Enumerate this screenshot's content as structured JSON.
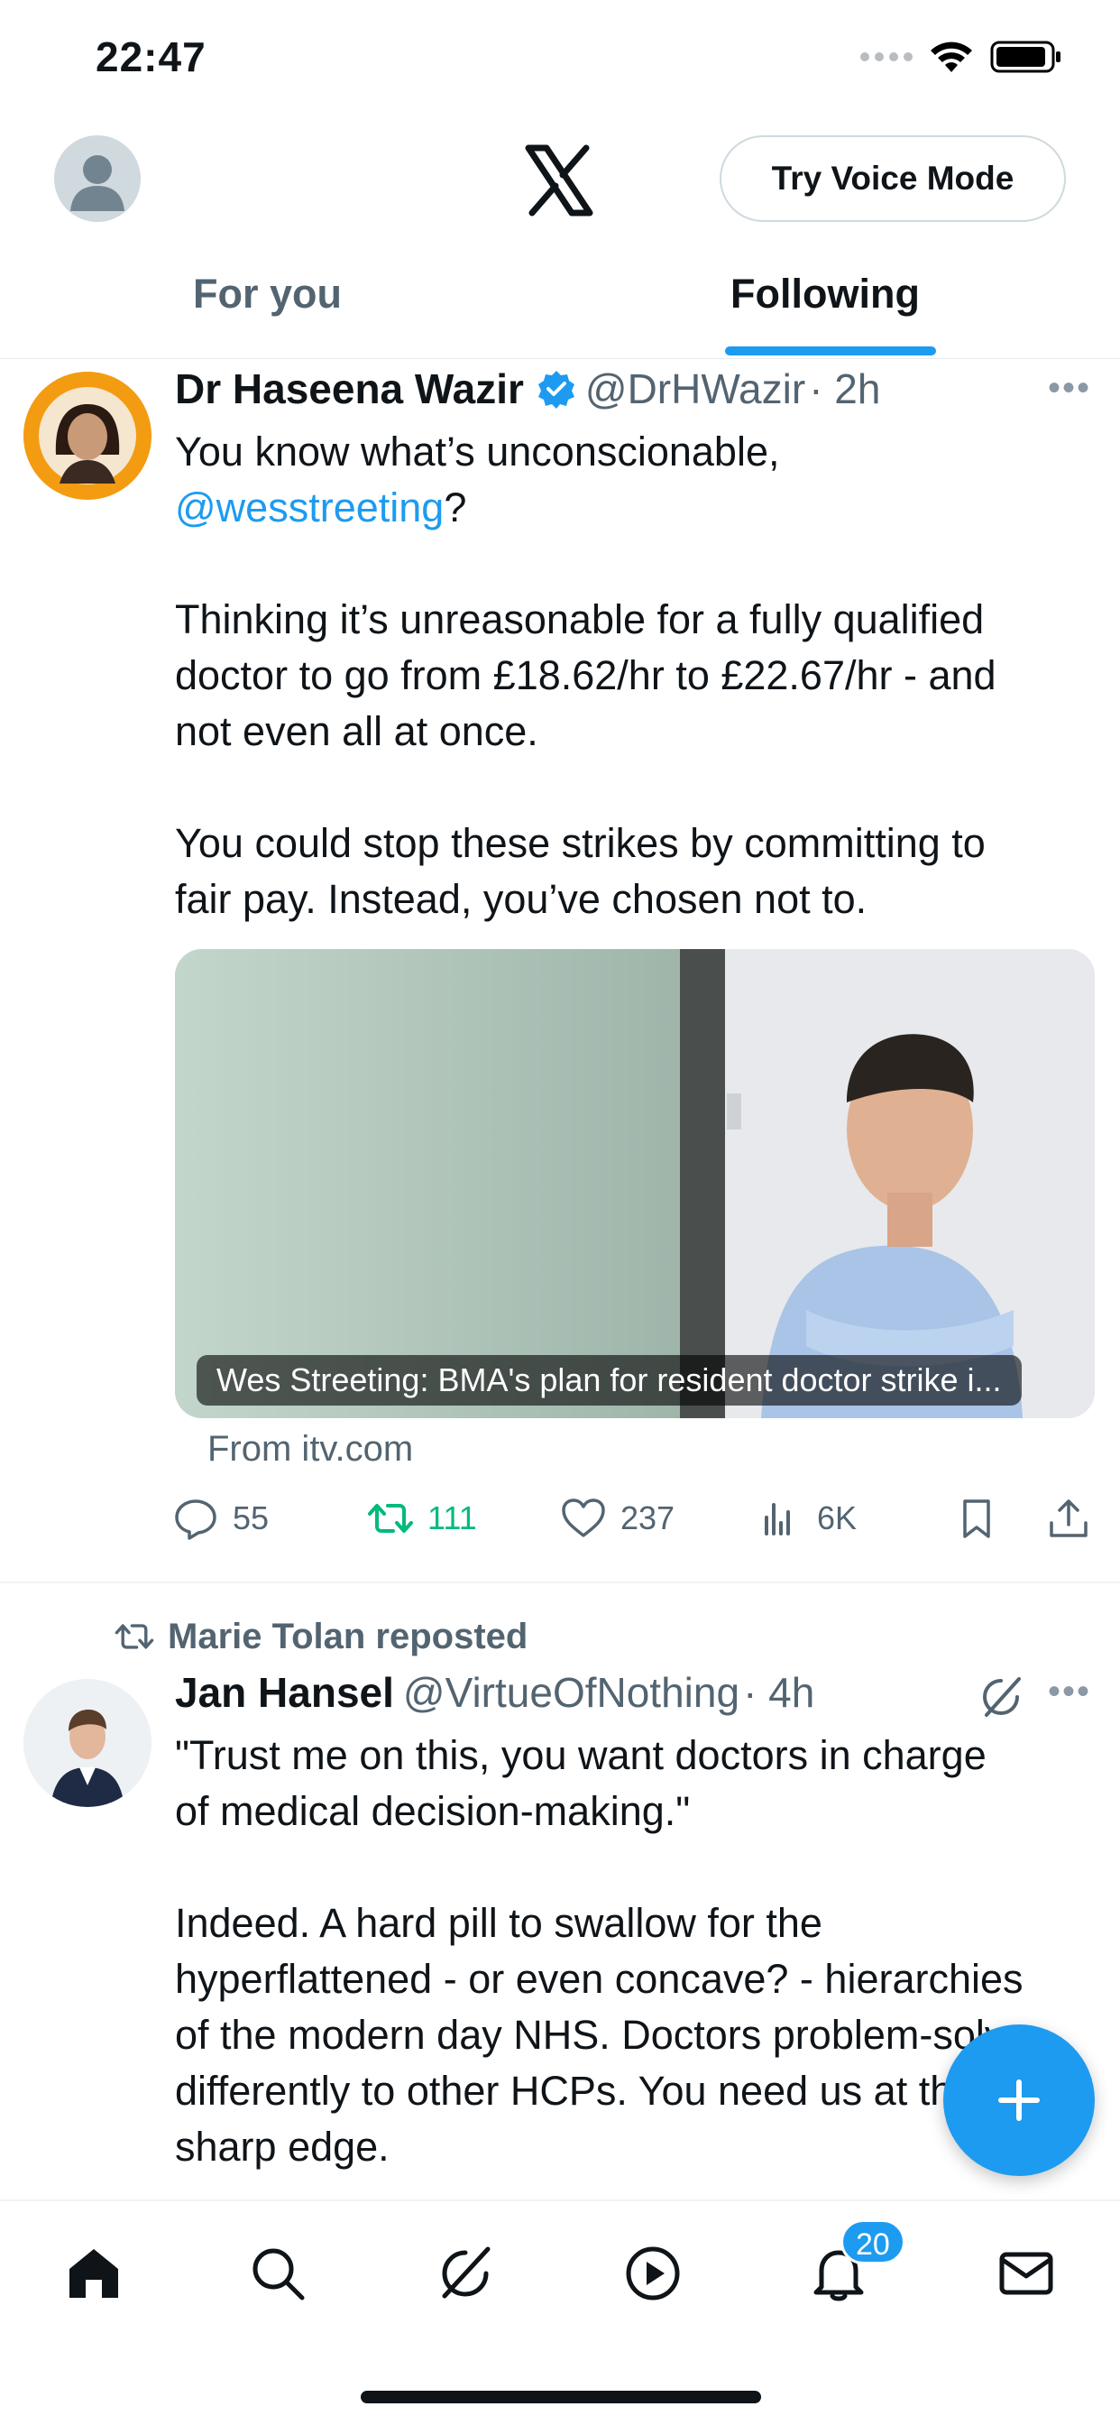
{
  "status_bar": {
    "time": "22:47"
  },
  "header": {
    "voice_button": "Try Voice Mode"
  },
  "tabs": [
    {
      "label": "For you"
    },
    {
      "label": "Following"
    }
  ],
  "tweets": [
    {
      "name": "Dr Haseena Wazir",
      "handle": "@DrHWazir",
      "time": "· 2h",
      "body_lines": [
        "You know what’s unconscionable,",
        "?",
        "Thinking it’s unreasonable for a fully qualified",
        "doctor to go from £18.62/hr to £22.67/hr - and",
        "not even all at once.",
        "You could stop these strikes by committing to",
        "fair pay. Instead, you’ve chosen not to."
      ],
      "mention": "@wesstreeting",
      "card_caption": "Wes Streeting: BMA's plan for resident doctor strike i...",
      "card_source": "From itv.com",
      "stats": {
        "replies": "55",
        "reposts": "111",
        "likes": "237",
        "views": "6K"
      }
    },
    {
      "repost_by": "Marie Tolan reposted",
      "name": "Jan Hansel",
      "handle": "@VirtueOfNothing",
      "time": "· 4h",
      "body_lines": [
        "\"Trust me on this, you want doctors in charge",
        "of medical decision-making.\"",
        "Indeed. A hard pill to swallow for the",
        "hyperflattened - or even concave? - hierarchies",
        "of the modern day NHS. Doctors problem-solve",
        "differently to other HCPs. You need us at the",
        "sharp edge."
      ]
    }
  ],
  "bottom_nav": {
    "notifications_badge": "20"
  },
  "colors": {
    "accent": "#1d9bf0",
    "repost_green": "#00ba7c",
    "muted": "#536471"
  }
}
